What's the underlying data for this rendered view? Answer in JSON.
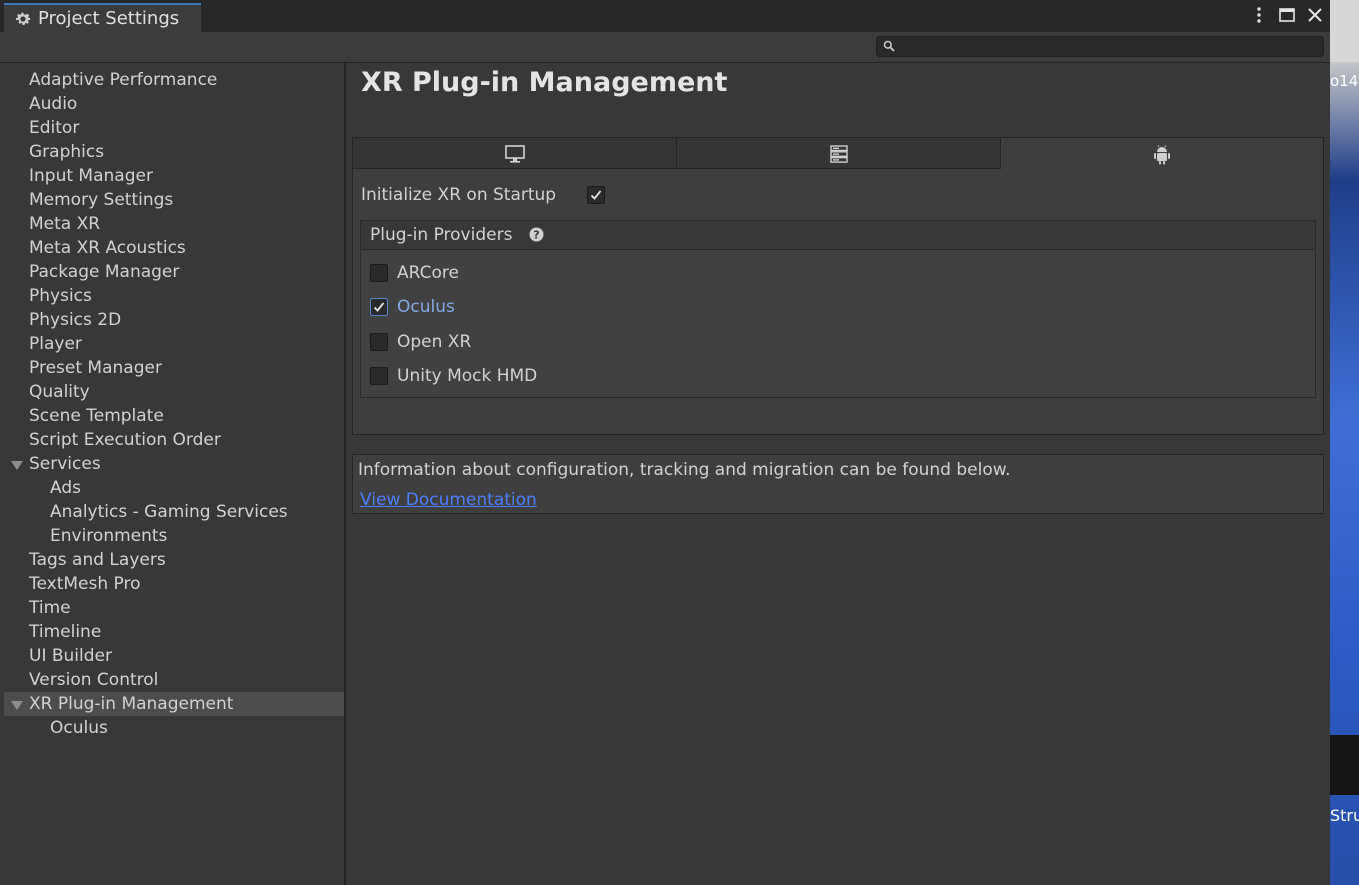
{
  "window": {
    "tab_title": "Project Settings",
    "controls": {
      "menu_icon": "kebab-menu-icon",
      "maximize_icon": "maximize-icon",
      "close_icon": "close-icon"
    }
  },
  "search": {
    "value": "",
    "placeholder": "",
    "icon": "search-icon"
  },
  "sidebar": {
    "items": [
      {
        "label": "Adaptive Performance",
        "level": 0
      },
      {
        "label": "Audio",
        "level": 0
      },
      {
        "label": "Editor",
        "level": 0
      },
      {
        "label": "Graphics",
        "level": 0
      },
      {
        "label": "Input Manager",
        "level": 0
      },
      {
        "label": "Memory Settings",
        "level": 0
      },
      {
        "label": "Meta XR",
        "level": 0
      },
      {
        "label": "Meta XR Acoustics",
        "level": 0
      },
      {
        "label": "Package Manager",
        "level": 0
      },
      {
        "label": "Physics",
        "level": 0
      },
      {
        "label": "Physics 2D",
        "level": 0
      },
      {
        "label": "Player",
        "level": 0
      },
      {
        "label": "Preset Manager",
        "level": 0
      },
      {
        "label": "Quality",
        "level": 0
      },
      {
        "label": "Scene Template",
        "level": 0
      },
      {
        "label": "Script Execution Order",
        "level": 0
      },
      {
        "label": "Services",
        "level": 0,
        "expanded": true
      },
      {
        "label": "Ads",
        "level": 1
      },
      {
        "label": "Analytics - Gaming Services",
        "level": 1
      },
      {
        "label": "Environments",
        "level": 1
      },
      {
        "label": "Tags and Layers",
        "level": 0
      },
      {
        "label": "TextMesh Pro",
        "level": 0
      },
      {
        "label": "Time",
        "level": 0
      },
      {
        "label": "Timeline",
        "level": 0
      },
      {
        "label": "UI Builder",
        "level": 0
      },
      {
        "label": "Version Control",
        "level": 0
      },
      {
        "label": "XR Plug-in Management",
        "level": 0,
        "expanded": true,
        "selected": true
      },
      {
        "label": "Oculus",
        "level": 1
      }
    ]
  },
  "main": {
    "title": "XR Plug-in Management",
    "platform_tabs": [
      {
        "icon": "desktop-icon",
        "active": false
      },
      {
        "icon": "server-icon",
        "active": false
      },
      {
        "icon": "android-icon",
        "active": true
      }
    ],
    "init_on_startup": {
      "label": "Initialize XR on Startup",
      "checked": true
    },
    "providers": {
      "title": "Plug-in Providers",
      "help_icon": "help-icon",
      "items": [
        {
          "label": "ARCore",
          "checked": false
        },
        {
          "label": "Oculus",
          "checked": true
        },
        {
          "label": "Open XR",
          "checked": false
        },
        {
          "label": "Unity Mock HMD",
          "checked": false
        }
      ]
    },
    "info": {
      "text": "Information about configuration, tracking and migration can be found below.",
      "link": "View Documentation"
    }
  },
  "background": {
    "fragment_top": "o14",
    "fragment_bottom": "Stru"
  }
}
